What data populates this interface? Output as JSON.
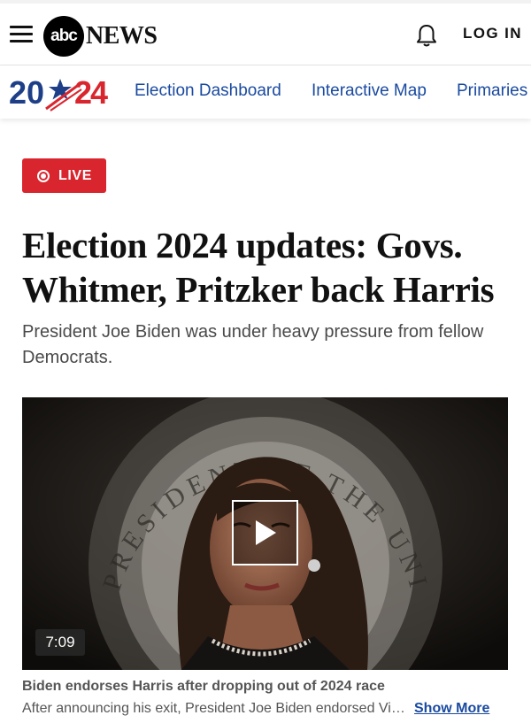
{
  "header": {
    "logo_mark": "abc",
    "logo_word": "NEWS",
    "menu_icon": "hamburger-menu-icon",
    "bell_icon": "bell-icon",
    "login_label": "LOG IN"
  },
  "subnav": {
    "brand": "2024",
    "links": [
      "Election Dashboard",
      "Interactive Map",
      "Primaries"
    ]
  },
  "article": {
    "live_label": "LIVE",
    "headline": "Election 2024 updates: Govs. Whitmer, Pritzker back Harris",
    "dek": "President Joe Biden was under heavy pressure from fellow Democrats."
  },
  "video": {
    "duration": "7:09",
    "play_icon": "play-icon",
    "seal_text": "PRESIDENT OF THE UNITED STATES",
    "caption": "Biden endorses Harris after dropping out of 2024 race",
    "description": "After announcing his exit, President Joe Biden endorsed Vice President Kamala Harris.",
    "show_more_label": "Show More"
  },
  "colors": {
    "accent_blue": "#1a4aa0",
    "live_red": "#d9262e",
    "brand_red": "#d9262e"
  }
}
